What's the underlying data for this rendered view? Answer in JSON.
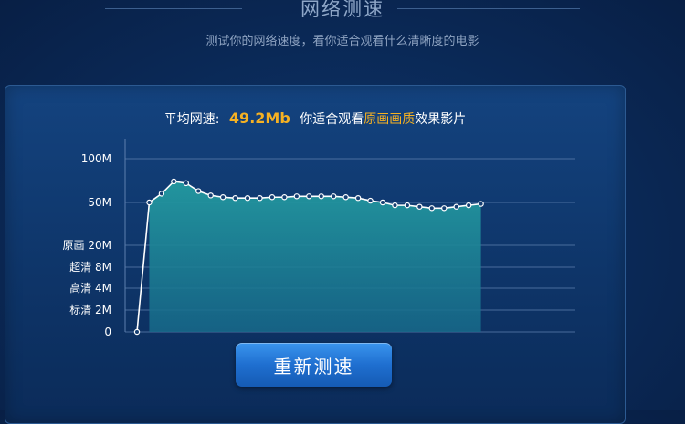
{
  "header": {
    "title": "网络测速",
    "subtitle": "测试你的网络速度，看你适合观看什么清晰度的电影"
  },
  "result": {
    "label": "平均网速:",
    "speed": "49.2Mb",
    "suggestion_prefix": "你适合观看",
    "quality": "原画画质",
    "suggestion_suffix": "效果影片"
  },
  "chart_data": {
    "type": "area",
    "title": "",
    "xlabel": "",
    "ylabel": "",
    "y_ticks": [
      {
        "label": "100M",
        "value": 100
      },
      {
        "label": "50M",
        "value": 50
      },
      {
        "label": "原画 20M",
        "value": 20
      },
      {
        "label": "超清 8M",
        "value": 8
      },
      {
        "label": "高清 4M",
        "value": 4
      },
      {
        "label": "标清 2M",
        "value": 2
      },
      {
        "label": "0",
        "value": 0
      }
    ],
    "x": [
      0,
      1,
      2,
      3,
      4,
      5,
      6,
      7,
      8,
      9,
      10,
      11,
      12,
      13,
      14,
      15,
      16,
      17,
      18,
      19,
      20,
      21,
      22,
      23,
      24,
      25,
      26,
      27,
      28
    ],
    "values": [
      0,
      50,
      60,
      74,
      72,
      63,
      58,
      56,
      55,
      55,
      55,
      56,
      56,
      57,
      57,
      57,
      57,
      56,
      55,
      52,
      50,
      48,
      48,
      47,
      46,
      46,
      47,
      48,
      49
    ],
    "grid": true,
    "colors": {
      "line": "#ffffff",
      "fill": "#1f8f96",
      "grid": "#5d7fae"
    }
  },
  "actions": {
    "retest_label": "重新测速"
  }
}
